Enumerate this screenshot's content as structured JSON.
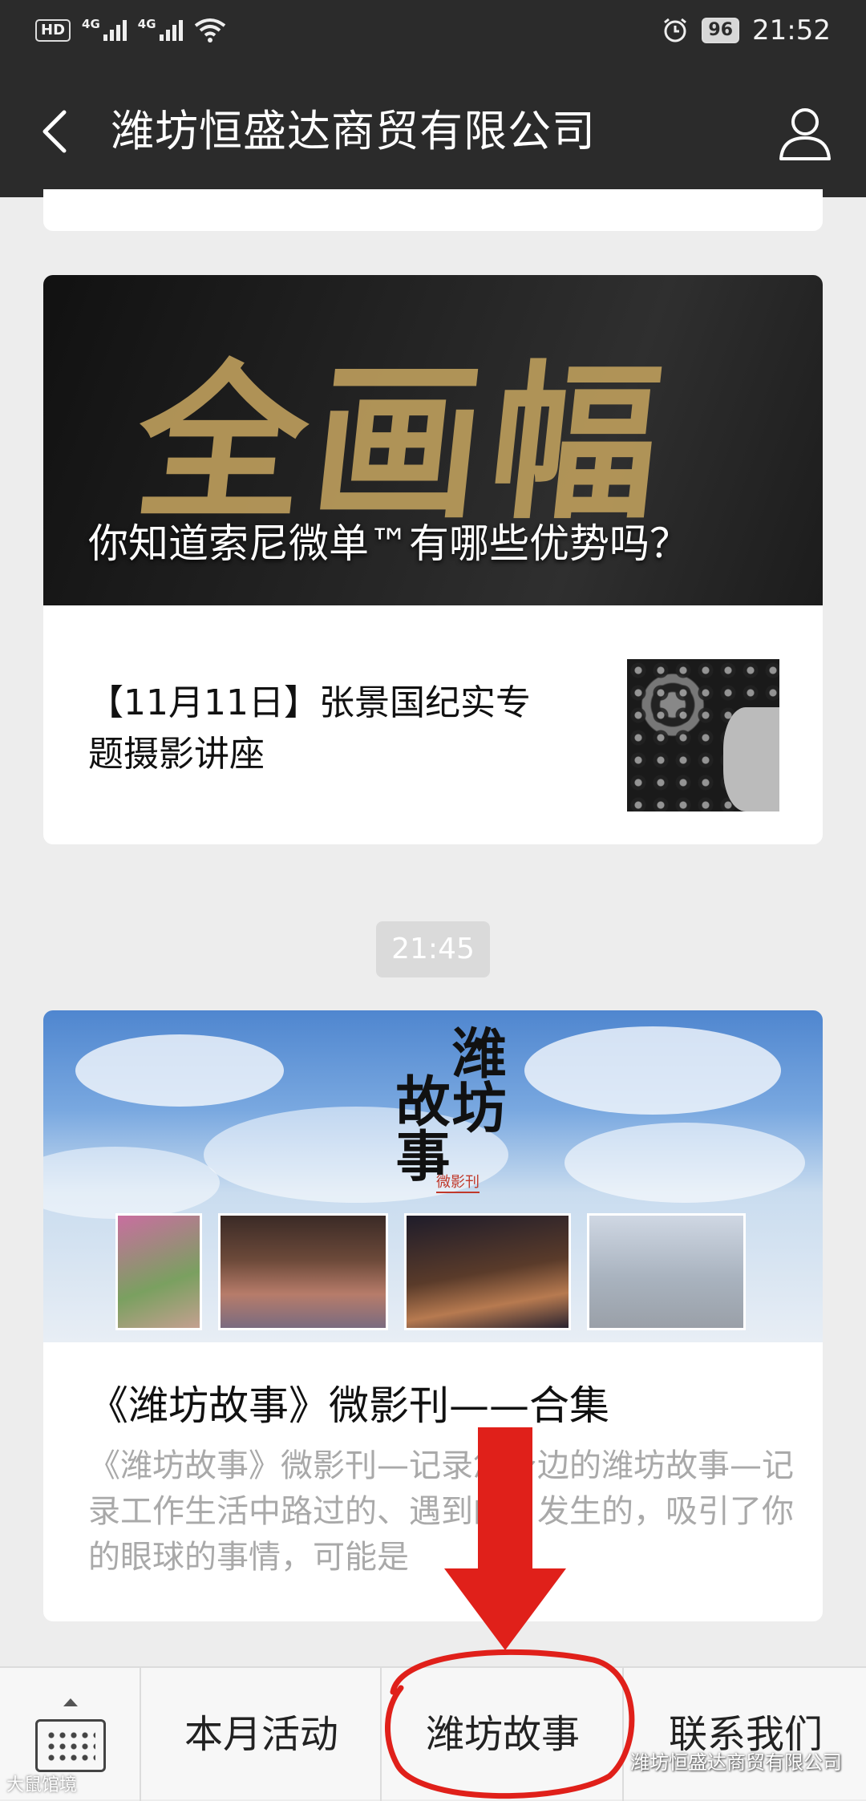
{
  "status_bar": {
    "hd": "HD",
    "net1": "4G",
    "net2": "4G",
    "battery": "96",
    "time": "21:52"
  },
  "header": {
    "title": "潍坊恒盛达商贸有限公司"
  },
  "articles": {
    "card1": {
      "cover_caption": "你知道索尼微单™有哪些优势吗？",
      "cover_calligraphy": "全画幅",
      "item_title": "【11月11日】张景国纪实专题摄影讲座"
    },
    "timestamp": "21:45",
    "card2": {
      "cover_title_1": "潍坊",
      "cover_title_2": "故事",
      "cover_sub": "微影刊",
      "title": "《潍坊故事》微影刊——合集",
      "desc": "《潍坊故事》微影刊—记录您身边的潍坊故事—记录工作生活中路过的、遇到的、发生的，吸引了你的眼球的事情，可能是"
    }
  },
  "bottom_menu": {
    "tab1": "本月活动",
    "tab2": "潍坊故事",
    "tab3": "联系我们"
  },
  "watermark": "潍坊恒盛达商贸有限公司",
  "watermark_corner": "大鼠馆境",
  "colors": {
    "topbar": "#2b2b2b",
    "background": "#ededed",
    "annotation": "#e0201a"
  }
}
